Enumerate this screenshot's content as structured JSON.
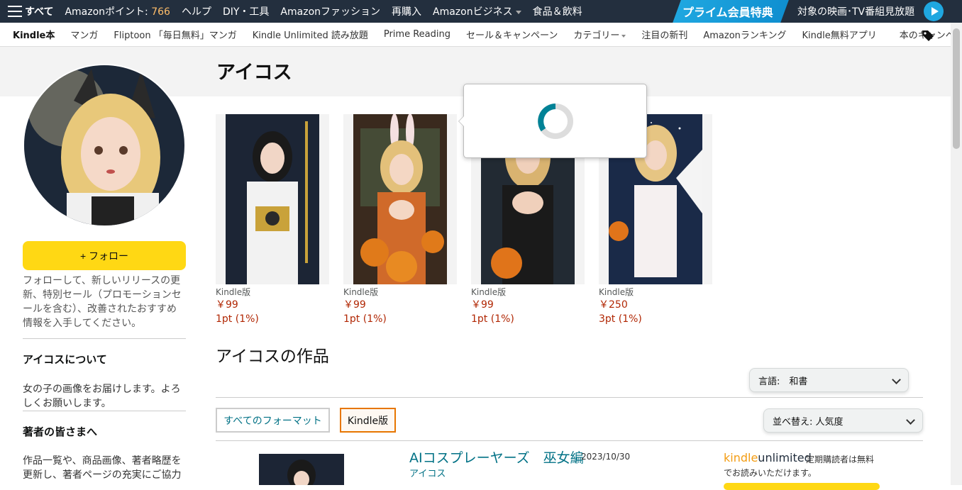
{
  "topnav": {
    "all_label": "すべて",
    "points_prefix": "Amazonポイント: ",
    "points_value": "766",
    "help": "ヘルプ",
    "diy": "DIY・工具",
    "fashion": "Amazonファッション",
    "rebuy": "再購入",
    "business": "Amazonビジネス",
    "food": "食品＆飲料"
  },
  "prime": {
    "badge": "プライム会員特典",
    "text": "対象の映画･TV番組見放題"
  },
  "subnav": {
    "items": [
      "Kindle本",
      "マンガ",
      "Fliptoon 「毎日無料」マンガ",
      "Kindle Unlimited 読み放題",
      "Prime Reading",
      "セール＆キャンペーン",
      "カテゴリー",
      "注目の新刊",
      "Amazonランキング",
      "Kindle無料アプリ"
    ],
    "campaign": "本のキャンペーン"
  },
  "author": {
    "name": "アイコス",
    "follow_label": "+ フォロー",
    "follow_desc": "フォローして、新しいリリースの更新、特別セール（プロモーションセールを含む）、改善されたおすすめ情報を入手してください。",
    "about_heading": "アイコスについて",
    "about_text": "女の子の画像をお届けします。よろしくお願いします。",
    "authors_heading": "著者の皆さまへ",
    "authors_text": "作品一覧や、商品画像、著者略歴を更新し、著者ページの充実にご協力"
  },
  "books": [
    {
      "format": "Kindle版",
      "price": "￥99",
      "points": "1pt (1%)"
    },
    {
      "format": "Kindle版",
      "price": "￥99",
      "points": "1pt (1%)"
    },
    {
      "format": "Kindle版",
      "price": "￥99",
      "points": "1pt (1%)"
    },
    {
      "format": "Kindle版",
      "price": "￥250",
      "points": "3pt (1%)"
    }
  ],
  "works": {
    "heading": "アイコスの作品",
    "language_select": "言語:　和書",
    "sort_select": "並べ替え: 人気度",
    "filter_all": "すべてのフォーマット",
    "filter_kindle": "Kindle版",
    "items": [
      {
        "title": "AIコスプレーヤーズ　巫女編",
        "date": "2023/10/30",
        "author": "アイコス",
        "ku_logo_k": "kindle",
        "ku_logo_u": "unlimited",
        "ku_note": "定期購読者は無料",
        "ku_note2": "でお読みいただけます。"
      }
    ]
  },
  "colors": {
    "nav_bg": "#232f3e",
    "accent_yellow": "#ffd814",
    "price_red": "#b12704",
    "link_teal": "#007185",
    "points_orange": "#febd69"
  }
}
